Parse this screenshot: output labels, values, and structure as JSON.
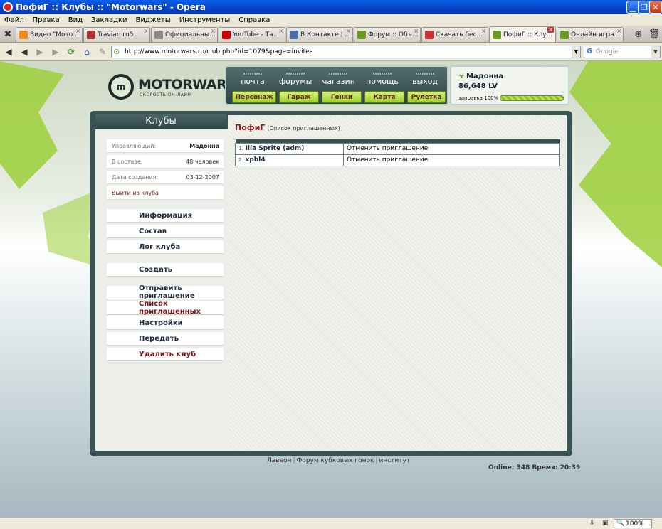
{
  "window": {
    "title": "ПофиГ :: Клубы :: \"Motorwars\" - Opera"
  },
  "menu": [
    "Файл",
    "Правка",
    "Вид",
    "Закладки",
    "Виджеты",
    "Инструменты",
    "Справка"
  ],
  "tabs": [
    {
      "label": "Видео \"Мото...",
      "color": "#f28a1a"
    },
    {
      "label": "Travian ru5",
      "color": "#a33"
    },
    {
      "label": "Официальны...",
      "color": "#888"
    },
    {
      "label": "YouTube - Та...",
      "color": "#c00"
    },
    {
      "label": "В Контакте | ...",
      "color": "#4a6ea8"
    },
    {
      "label": "Форум :: Объ...",
      "color": "#6a9a20"
    },
    {
      "label": "Скачать бес...",
      "color": "#c33"
    },
    {
      "label": "ПофиГ :: Клу...",
      "color": "#6a9a20",
      "active": true
    },
    {
      "label": "Онлайн игра ...",
      "color": "#6a9a20"
    }
  ],
  "address": {
    "url": "http://www.motorwars.ru/club.php?id=1079&page=invites",
    "search_placeholder": "Google"
  },
  "site": {
    "logo_name": "MOTORWARS.RU",
    "logo_slogan": "СКОРОСТЬ ОН-ЛАЙН",
    "logo_badge": "m",
    "topnav": [
      "почта",
      "форумы",
      "магазин",
      "помощь",
      "выход"
    ],
    "buttons": [
      "Персонаж",
      "Гараж",
      "Гонки",
      "Карта",
      "Рулетка"
    ],
    "user": {
      "name": "Мадонна",
      "money": "86,648 LV",
      "fuel_label": "заправка 100%",
      "fuel": 1.0
    }
  },
  "sidebar": {
    "title": "Клубы",
    "info": [
      {
        "label": "Управляющий:",
        "value": "Мадонна"
      },
      {
        "label": "В составе:",
        "value": "48 человек"
      },
      {
        "label": "Дата создания:",
        "value": "03-12-2007"
      }
    ],
    "leave": "Выйти из клуба",
    "group1": [
      "Информация",
      "Состав",
      "Лог клуба"
    ],
    "group2": [
      "Создать"
    ],
    "group3": [
      {
        "label": "Отправить приглашение",
        "red": false
      },
      {
        "label": "Список приглашенных",
        "red": true
      },
      {
        "label": "Настройки",
        "red": false
      },
      {
        "label": "Передать",
        "red": false
      },
      {
        "label": "Удалить клуб",
        "red": true
      }
    ]
  },
  "content": {
    "club": "ПофиГ",
    "subtitle": "(Список приглашенных)",
    "invites": [
      {
        "num": "1.",
        "name": "Ilia Sprite (adm)",
        "action": "Отменить приглашение"
      },
      {
        "num": "2.",
        "name": "xpbl4",
        "action": "Отменить приглашение"
      }
    ]
  },
  "footer": {
    "links": [
      "Лавеон",
      "Форум кубковых гонок",
      "институт"
    ],
    "online": "Online: 348  Время: 20:39"
  },
  "statusbar": {
    "zoom": "100%"
  }
}
